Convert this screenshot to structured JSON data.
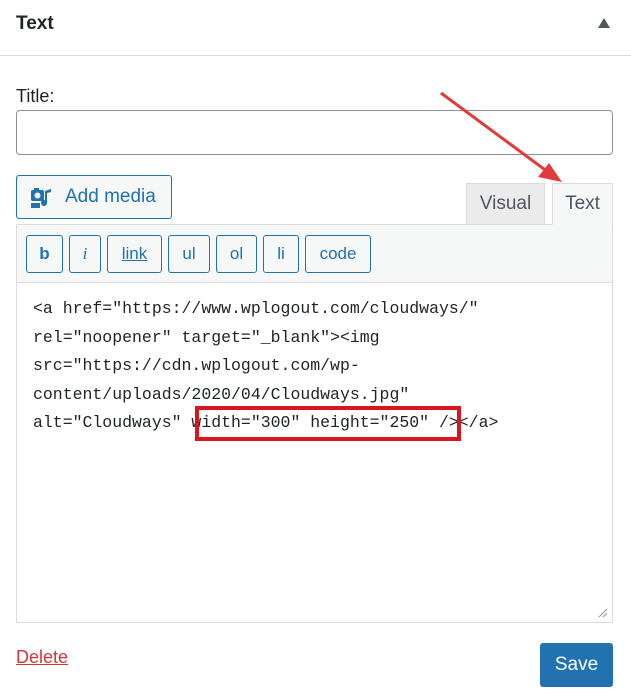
{
  "widget": {
    "title": "Text"
  },
  "form": {
    "title_label": "Title:",
    "title_value": ""
  },
  "editor": {
    "add_media_label": "Add media",
    "tabs": {
      "visual": "Visual",
      "text": "Text"
    },
    "active_tab": "Text",
    "quicktags": [
      "b",
      "i",
      "link",
      "ul",
      "ol",
      "li",
      "code"
    ],
    "content_lines": [
      "<a href=\"https://www.wplogout.com/cloudways/\"",
      "rel=\"noopener\" target=\"_blank\"><img",
      "src=\"https://cdn.wplogout.com/wp-",
      "content/uploads/2020/04/Cloudways.jpg\"",
      "alt=\"Cloudways\" width=\"300\" height=\"250\" /></a>"
    ],
    "highlighted_text": "width=\"300\" height=\"250\""
  },
  "actions": {
    "delete_label": "Delete",
    "save_label": "Save"
  },
  "colors": {
    "accent": "#2271b1",
    "delete": "#d63638",
    "highlight_box": "#d9151d",
    "annotation_arrow": "#e03c3c"
  },
  "icons": [
    "collapse-up-icon",
    "add-media-icon",
    "resize-handle-icon",
    "annotation-arrow"
  ]
}
